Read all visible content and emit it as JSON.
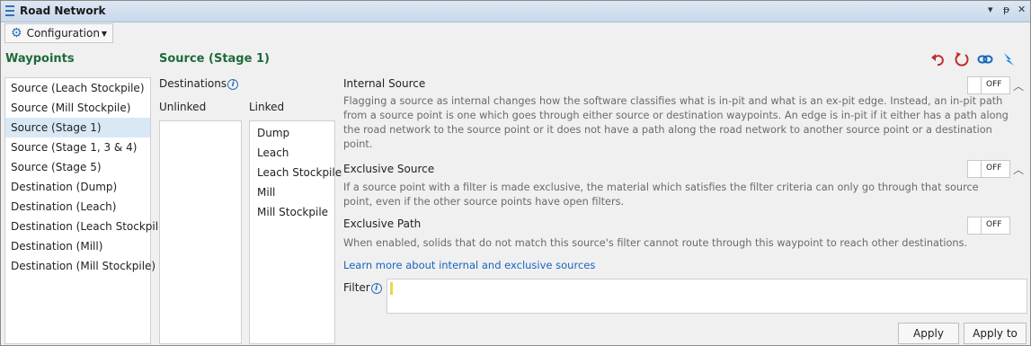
{
  "window": {
    "title": "Road Network",
    "menu_icon": "hamburger-icon",
    "dropdown_glyph": "▾",
    "pin_glyph": "ᵽ",
    "close_glyph": "✕"
  },
  "toolbar": {
    "configuration_label": "Configuration",
    "icon": "gear-icon"
  },
  "waypoints": {
    "title": "Waypoints",
    "items": [
      {
        "label": "Source (Leach Stockpile)",
        "selected": false
      },
      {
        "label": "Source (Mill Stockpile)",
        "selected": false
      },
      {
        "label": "Source (Stage 1)",
        "selected": true
      },
      {
        "label": "Source (Stage 1, 3 & 4)",
        "selected": false
      },
      {
        "label": "Source (Stage 5)",
        "selected": false
      },
      {
        "label": "Destination (Dump)",
        "selected": false
      },
      {
        "label": "Destination (Leach)",
        "selected": false
      },
      {
        "label": "Destination (Leach Stockpile)",
        "selected": false
      },
      {
        "label": "Destination (Mill)",
        "selected": false
      },
      {
        "label": "Destination (Mill Stockpile)",
        "selected": false
      }
    ]
  },
  "detail": {
    "title": "Source (Stage 1)",
    "actions": {
      "undo": "undo-icon",
      "reset": "reset-icon",
      "link": "link-icon",
      "flash": "lightning-icon"
    },
    "destinations": {
      "label": "Destinations",
      "info_glyph": "i",
      "unlinked_label": "Unlinked",
      "linked_label": "Linked",
      "unlinked": [],
      "linked": [
        "Dump",
        "Leach",
        "Leach Stockpile",
        "Mill",
        "Mill Stockpile"
      ]
    },
    "internal_source": {
      "title": "Internal Source",
      "description": "Flagging a source as internal changes how the software classifies what is in-pit and what is an ex-pit edge. Instead, an in-pit path from a source point is one which goes through either source or destination waypoints. An edge is in-pit if it either has a path along the road network to the source point or it does not have a path along the road network to another source point or a destination point.",
      "toggle": "OFF"
    },
    "exclusive_source": {
      "title": "Exclusive Source",
      "description": "If a source point with a filter is made exclusive, the material which satisfies the filter criteria can only go through that source point, even if the other source points have open filters.",
      "toggle": "OFF"
    },
    "exclusive_path": {
      "title": "Exclusive Path",
      "description": "When enabled, solids that do not match this source's filter cannot route through this waypoint to reach other destinations.",
      "toggle": "OFF"
    },
    "learn_more": "Learn more about internal and exclusive sources",
    "filter": {
      "label": "Filter",
      "info_glyph": "i",
      "value": ""
    },
    "apply_filter": "Apply Filter",
    "apply_to_all": "Apply to All"
  }
}
